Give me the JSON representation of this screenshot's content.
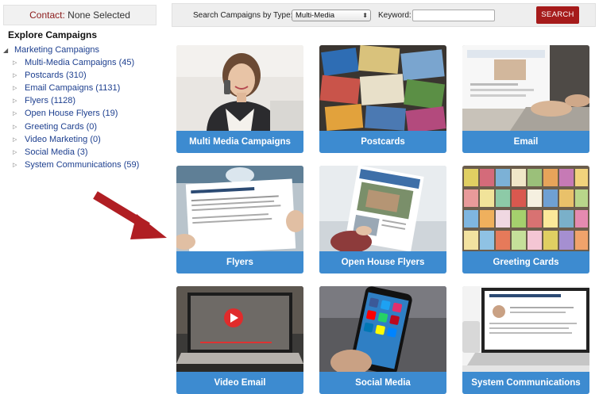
{
  "contact": {
    "label": "Contact:",
    "value": "None Selected"
  },
  "explore": {
    "title": "Explore Campaigns",
    "root": "Marketing Campaigns",
    "items": [
      {
        "label": "Multi-Media Campaigns (45)"
      },
      {
        "label": "Postcards (310)"
      },
      {
        "label": "Email Campaigns (1131)"
      },
      {
        "label": "Flyers (1128)"
      },
      {
        "label": "Open House Flyers (19)"
      },
      {
        "label": "Greeting Cards (0)"
      },
      {
        "label": "Video Marketing (0)"
      },
      {
        "label": "Social Media (3)"
      },
      {
        "label": "System Communications (59)"
      }
    ]
  },
  "search": {
    "type_label": "Search Campaigns by Type:",
    "type_value": "Multi-Media",
    "keyword_label": "Keyword:",
    "keyword_value": "",
    "button": "SEARCH"
  },
  "cards": [
    {
      "title": "Multi Media Campaigns"
    },
    {
      "title": "Postcards"
    },
    {
      "title": "Email"
    },
    {
      "title": "Flyers"
    },
    {
      "title": "Open House Flyers"
    },
    {
      "title": "Greeting Cards"
    },
    {
      "title": "Video Email"
    },
    {
      "title": "Social Media"
    },
    {
      "title": "System Communications"
    }
  ],
  "colors": {
    "accent_blue": "#3d8bd0",
    "search_button": "#a61b1b",
    "arrow": "#b01e23",
    "link": "#1d3f8f"
  }
}
